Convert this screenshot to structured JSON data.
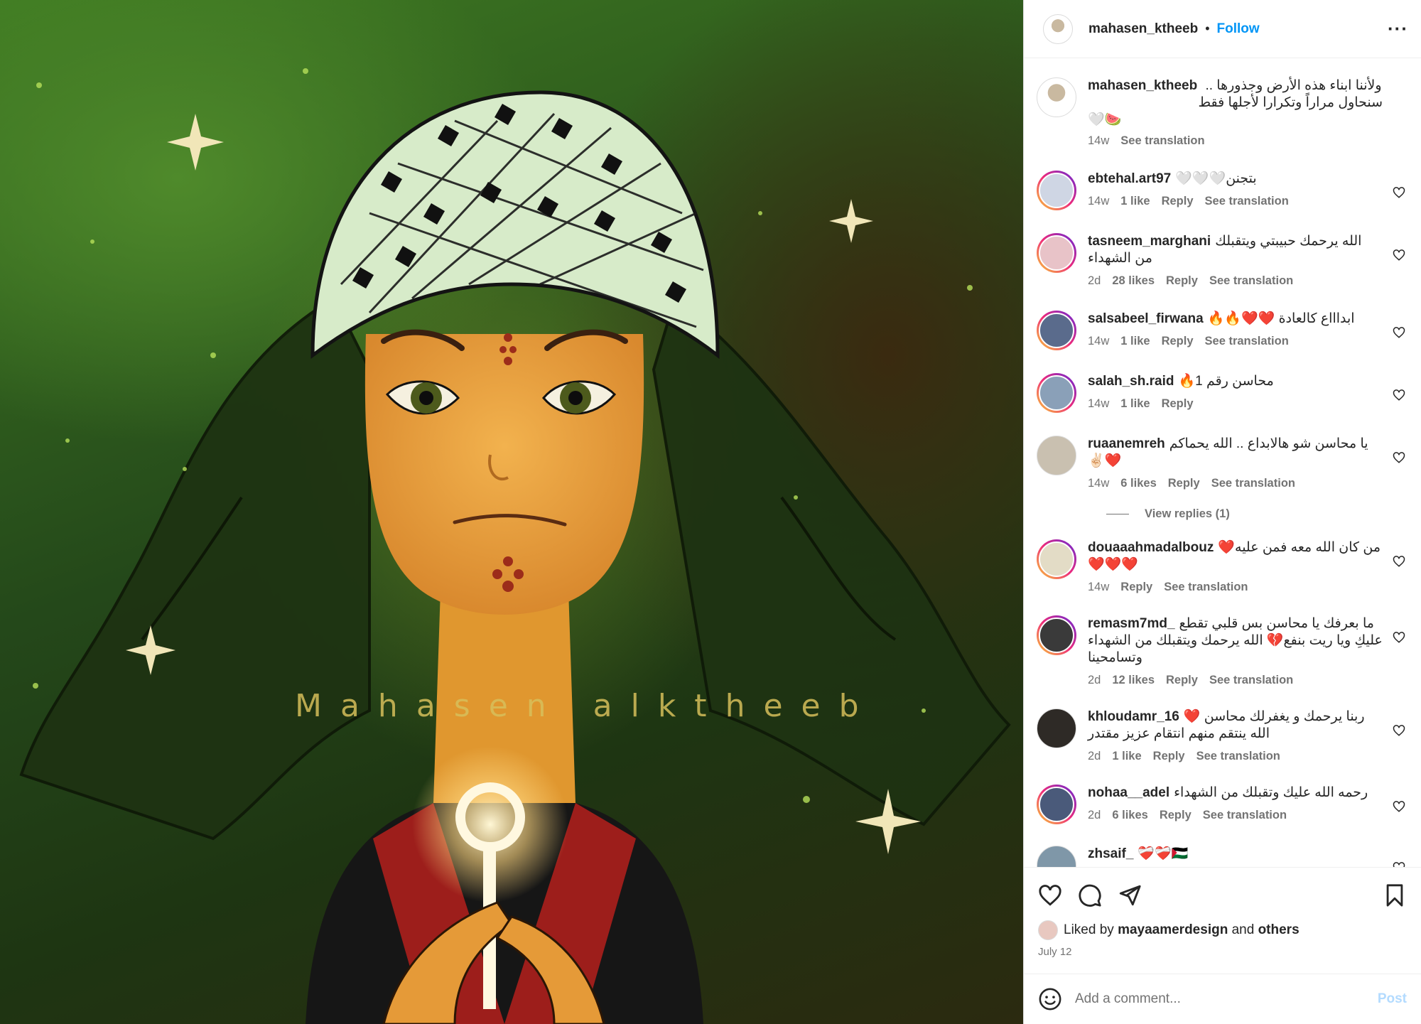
{
  "post": {
    "image_watermark": "Mahasen alktheeb",
    "author": "mahasen_ktheeb",
    "follow_label": "Follow",
    "more_icon": "more-options-icon"
  },
  "caption": {
    "user": "mahasen_ktheeb",
    "line1": "ولأننا ابناء هذه الأرض وجذورها ..",
    "line2": "سنحاول مراراً وتكرارا لأجلها فقط",
    "line3": "🤍🍉",
    "time": "14w",
    "see_translation": "See translation"
  },
  "comments": [
    {
      "user": "ebtehal.art97",
      "text": "بتجنن🤍🤍🤍",
      "time": "14w",
      "likes": "1 like",
      "reply": "Reply",
      "translate": "See translation"
    },
    {
      "user": "tasneem_marghani",
      "text": "الله يرحمك حبيبتي ويتقبلك من الشهداء",
      "time": "2d",
      "likes": "28 likes",
      "reply": "Reply",
      "translate": "See translation"
    },
    {
      "user": "salsabeel_firwana",
      "text": "ابداااع كالعادة ❤️❤️🔥🔥",
      "time": "14w",
      "likes": "1 like",
      "reply": "Reply",
      "translate": "See translation"
    },
    {
      "user": "salah_sh.raid",
      "text": "محاسن رقم 1🔥",
      "time": "14w",
      "likes": "1 like",
      "reply": "Reply",
      "translate": ""
    },
    {
      "user": "ruaanemreh",
      "text": "يا محاسن شو هالابداع .. الله يحماكم ❤️✌🏻",
      "time": "14w",
      "likes": "6 likes",
      "reply": "Reply",
      "translate": "See translation"
    },
    {
      "user": "douaaahmadalbouz",
      "text": "من كان الله معه فمن عليه❤️❤️❤️❤️",
      "time": "14w",
      "likes": "",
      "reply": "Reply",
      "translate": "See translation"
    },
    {
      "user": "remasm7md_",
      "text": "ما بعرفك يا محاسن بس قلبي تقطع عليكِ ويا ريت بنفع💔 الله يرحمك ويتقبلك من الشهداء وتسامحينا",
      "time": "2d",
      "likes": "12 likes",
      "reply": "Reply",
      "translate": "See translation"
    },
    {
      "user": "khloudamr_16",
      "text": "ربنا يرحمك و يغفرلك محاسن ❤️ الله ينتقم منهم انتقام عزيز مقتدر",
      "time": "2d",
      "likes": "1 like",
      "reply": "Reply",
      "translate": "See translation"
    },
    {
      "user": "nohaa__adel",
      "text": "رحمه الله عليك وتقبلك من الشهداء",
      "time": "2d",
      "likes": "6 likes",
      "reply": "Reply",
      "translate": "See translation"
    },
    {
      "user": "zhsaif_",
      "text": "❤️‍🩹❤️‍🩹🇵🇸",
      "time": "",
      "likes": "",
      "reply": "",
      "translate": ""
    }
  ],
  "view_replies": "View replies (1)",
  "actions": {
    "liked_by_prefix": "Liked by",
    "liked_by_user": "mayaamerdesign",
    "and": "and",
    "others": "others",
    "date": "July 12"
  },
  "add_comment": {
    "placeholder": "Add a comment...",
    "post_label": "Post"
  },
  "colors": {
    "accent": "#0095f6",
    "post_disabled": "#b3dbff",
    "muted": "#737373"
  }
}
